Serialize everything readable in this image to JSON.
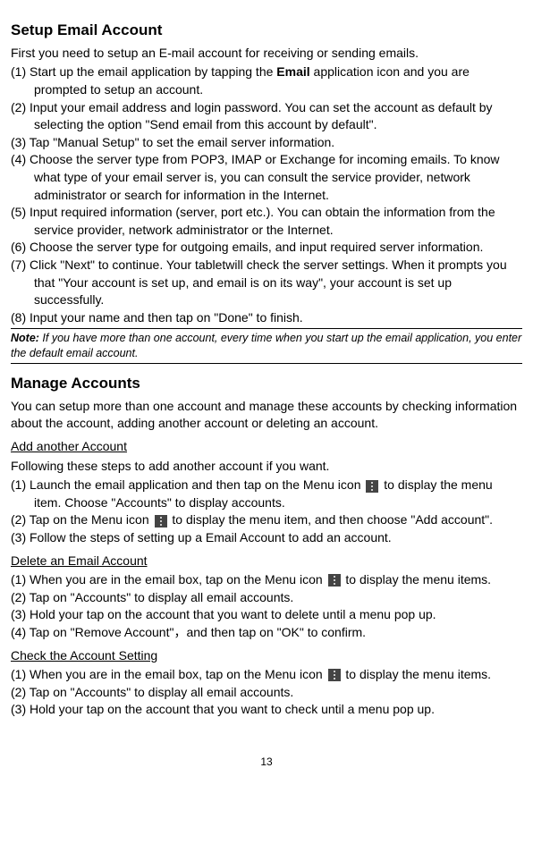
{
  "setup": {
    "heading": "Setup Email Account",
    "intro": "First you need to setup an E-mail account for receiving or sending emails.",
    "steps": {
      "s1_pre": "(1) Start up the email application by tapping the ",
      "s1_bold": "Email",
      "s1_post": " application icon and you are prompted to setup an account.",
      "s2": "(2) Input your email address and login password. You can set the account as default by selecting the option \"Send email from this account by default\".",
      "s3": "(3) Tap \"Manual Setup\" to set the email server information.",
      "s4": "(4) Choose the server type from POP3, IMAP or Exchange for incoming emails. To know what type of your email server is, you can consult the service provider, network administrator or search for information in the Internet.",
      "s5": "(5) Input required information (server, port etc.). You can obtain the information from the service provider, network administrator or the Internet.",
      "s6": "(6) Choose the server type for outgoing emails, and input required server information.",
      "s7": "(7) Click \"Next\" to continue. Your tabletwill check the server settings. When it prompts you that \"Your account is set up, and email is on its way\", your account is set up successfully.",
      "s8": "(8) Input your name and then tap on \"Done\" to finish."
    },
    "note_label": "Note:",
    "note_text": " If you have more than one account, every time when you start up the email application, you enter the default email account."
  },
  "manage": {
    "heading": "Manage Accounts",
    "intro": "You can setup more than one account and manage these accounts by checking information about the account, adding another account or deleting an account."
  },
  "add": {
    "subheading": "Add another Account",
    "intro": "Following these steps to add another account if you want.",
    "s1_pre": "(1) Launch the email application and then tap on the Menu icon ",
    "s1_post": " to display the menu item. Choose \"Accounts\" to display accounts.",
    "s2_pre": "(2) Tap on the Menu icon ",
    "s2_post": " to display the menu item, and then choose \"Add account\".",
    "s3": "(3) Follow the steps of setting up a Email Account to add an account."
  },
  "delete": {
    "subheading": "Delete an Email Account",
    "s1_pre": "(1) When you are in the email box, tap on the Menu icon ",
    "s1_post": " to display the menu items.",
    "s2": "(2) Tap on \"Accounts\" to display all email accounts.",
    "s3": "(3) Hold your tap on the account that you want to delete until a menu pop up.",
    "s4": "(4) Tap on \"Remove Account\"，and then tap on \"OK\" to confirm."
  },
  "check": {
    "subheading": "Check the Account Setting",
    "s1_pre": "(1) When you are in the email box, tap on the Menu icon ",
    "s1_post": " to display the menu items.",
    "s2": "(2) Tap on \"Accounts\" to display all email accounts.",
    "s3": "(3) Hold your tap on the account that you want to check until a menu pop up."
  },
  "page_number": "13"
}
